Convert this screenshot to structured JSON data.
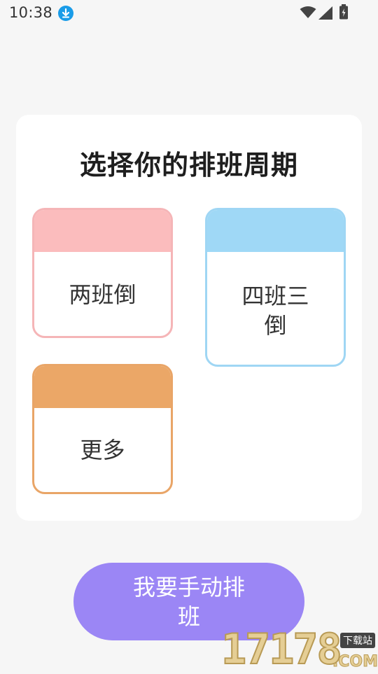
{
  "status_bar": {
    "time": "10:38",
    "icons": [
      "download-icon",
      "wifi-icon",
      "signal-icon",
      "battery-icon"
    ]
  },
  "card": {
    "title": "选择你的排班周期",
    "options": [
      {
        "label": "两班倒",
        "color": "#fbbcbd"
      },
      {
        "label": "四班三倒",
        "color": "#9fd8f6"
      },
      {
        "label": "更多",
        "color": "#eba767"
      }
    ]
  },
  "manual_button": {
    "label": "我要手动排班",
    "color": "#9b86f5"
  },
  "watermark": {
    "number": "17178",
    "badge": "下载站",
    "suffix": ".COM"
  }
}
